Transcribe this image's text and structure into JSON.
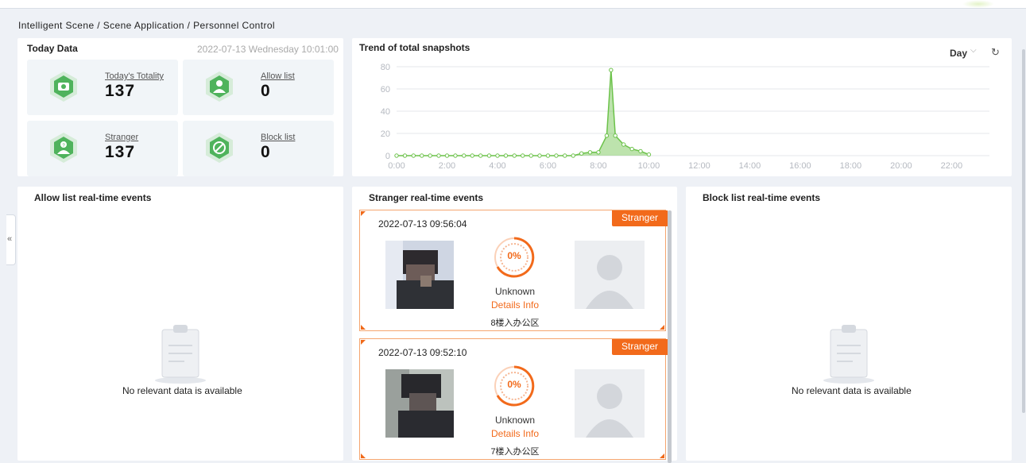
{
  "breadcrumb": "Intelligent Scene / Scene Application / Personnel Control",
  "collapse_label": "«",
  "today": {
    "title": "Today Data",
    "datetime": "2022-07-13 Wednesday 10:01:00",
    "stats": [
      {
        "label": "Today's Totality",
        "value": "137",
        "icon": "camera-icon"
      },
      {
        "label": "Allow list",
        "value": "0",
        "icon": "allow-person-icon"
      },
      {
        "label": "Stranger",
        "value": "137",
        "icon": "stranger-icon"
      },
      {
        "label": "Block list",
        "value": "0",
        "icon": "block-person-icon"
      }
    ]
  },
  "trend": {
    "title": "Trend of total snapshots",
    "period": "Day",
    "period_chevron": "⌵",
    "refresh_icon": "↻"
  },
  "chart_data": {
    "type": "area",
    "title": "Trend of total snapshots",
    "xlabel": "",
    "ylabel": "",
    "ylim": [
      0,
      80
    ],
    "yticks": [
      "0",
      "20",
      "40",
      "60",
      "80"
    ],
    "xticks": [
      "0:00",
      "2:00",
      "4:00",
      "6:00",
      "8:00",
      "10:00",
      "12:00",
      "14:00",
      "16:00",
      "18:00",
      "20:00",
      "22:00"
    ],
    "xlim": [
      0,
      23.5
    ],
    "grid": true,
    "color": "#6cc24a",
    "x": [
      0,
      0.33,
      0.67,
      1,
      1.33,
      1.67,
      2,
      2.33,
      2.67,
      3,
      3.33,
      3.67,
      4,
      4.33,
      4.67,
      5,
      5.33,
      5.67,
      6,
      6.33,
      6.67,
      7,
      7.33,
      7.67,
      8,
      8.33,
      8.5,
      8.67,
      9,
      9.33,
      9.67,
      10
    ],
    "values": [
      0,
      0,
      0,
      0,
      0,
      0,
      0,
      0,
      0,
      0,
      0,
      0,
      0,
      0,
      0,
      0,
      0,
      0,
      0,
      0,
      0,
      0,
      2,
      3,
      3,
      18,
      77,
      18,
      10,
      6,
      4,
      1
    ]
  },
  "allow_events": {
    "title": "Allow list real-time events",
    "empty": "No relevant data is available"
  },
  "stranger_events": {
    "title": "Stranger real-time events",
    "items": [
      {
        "time": "2022-07-13 09:56:04",
        "badge": "Stranger",
        "percent": "0%",
        "name": "Unknown",
        "details": "Details Info",
        "location": "8楼入办公区"
      },
      {
        "time": "2022-07-13 09:52:10",
        "badge": "Stranger",
        "percent": "0%",
        "name": "Unknown",
        "details": "Details Info",
        "location": "7楼入办公区"
      }
    ]
  },
  "block_events": {
    "title": "Block list real-time events",
    "empty": "No relevant data is available"
  },
  "colors": {
    "accent": "#f26a1b",
    "chart": "#6cc24a",
    "hex_icon": "#4fb35c"
  }
}
